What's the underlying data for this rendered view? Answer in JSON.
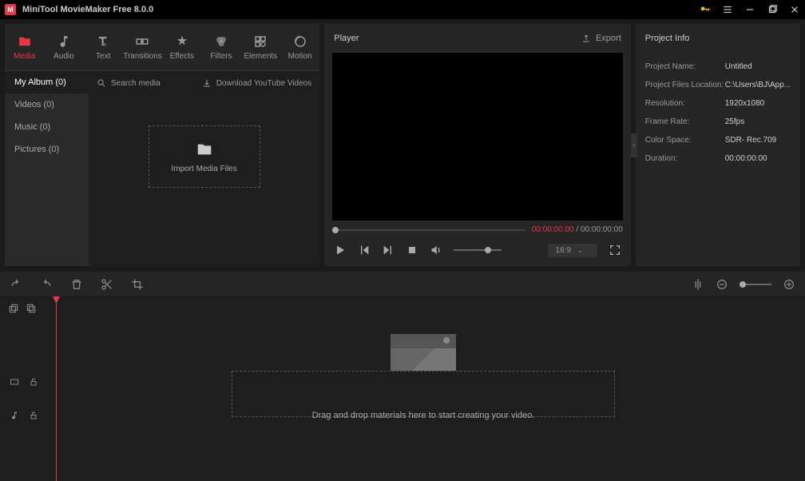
{
  "titlebar": {
    "app_name": "MiniTool MovieMaker Free 8.0.0"
  },
  "tabs": [
    {
      "id": "media",
      "label": "Media"
    },
    {
      "id": "audio",
      "label": "Audio"
    },
    {
      "id": "text",
      "label": "Text"
    },
    {
      "id": "transitions",
      "label": "Transitions"
    },
    {
      "id": "effects",
      "label": "Effects"
    },
    {
      "id": "filters",
      "label": "Filters"
    },
    {
      "id": "elements",
      "label": "Elements"
    },
    {
      "id": "motion",
      "label": "Motion"
    }
  ],
  "sidebar": [
    {
      "label": "My Album (0)",
      "active": true
    },
    {
      "label": "Videos (0)"
    },
    {
      "label": "Music (0)"
    },
    {
      "label": "Pictures (0)"
    }
  ],
  "content": {
    "search_label": "Search media",
    "download_label": "Download YouTube Videos",
    "import_label": "Import Media Files"
  },
  "player": {
    "header": "Player",
    "export_label": "Export",
    "current_time": "00:00:00.00",
    "total_time": "00:00:00:00",
    "aspect": "16:9"
  },
  "project": {
    "header": "Project Info",
    "rows": [
      {
        "label": "Project Name:",
        "value": "Untitled"
      },
      {
        "label": "Project Files Location:",
        "value": "C:\\Users\\BJ\\App..."
      },
      {
        "label": "Resolution:",
        "value": "1920x1080"
      },
      {
        "label": "Frame Rate:",
        "value": "25fps"
      },
      {
        "label": "Color Space:",
        "value": "SDR- Rec.709"
      },
      {
        "label": "Duration:",
        "value": "00:00:00:00"
      }
    ]
  },
  "timeline": {
    "drop_text": "Drag and drop materials here to start creating your video."
  }
}
